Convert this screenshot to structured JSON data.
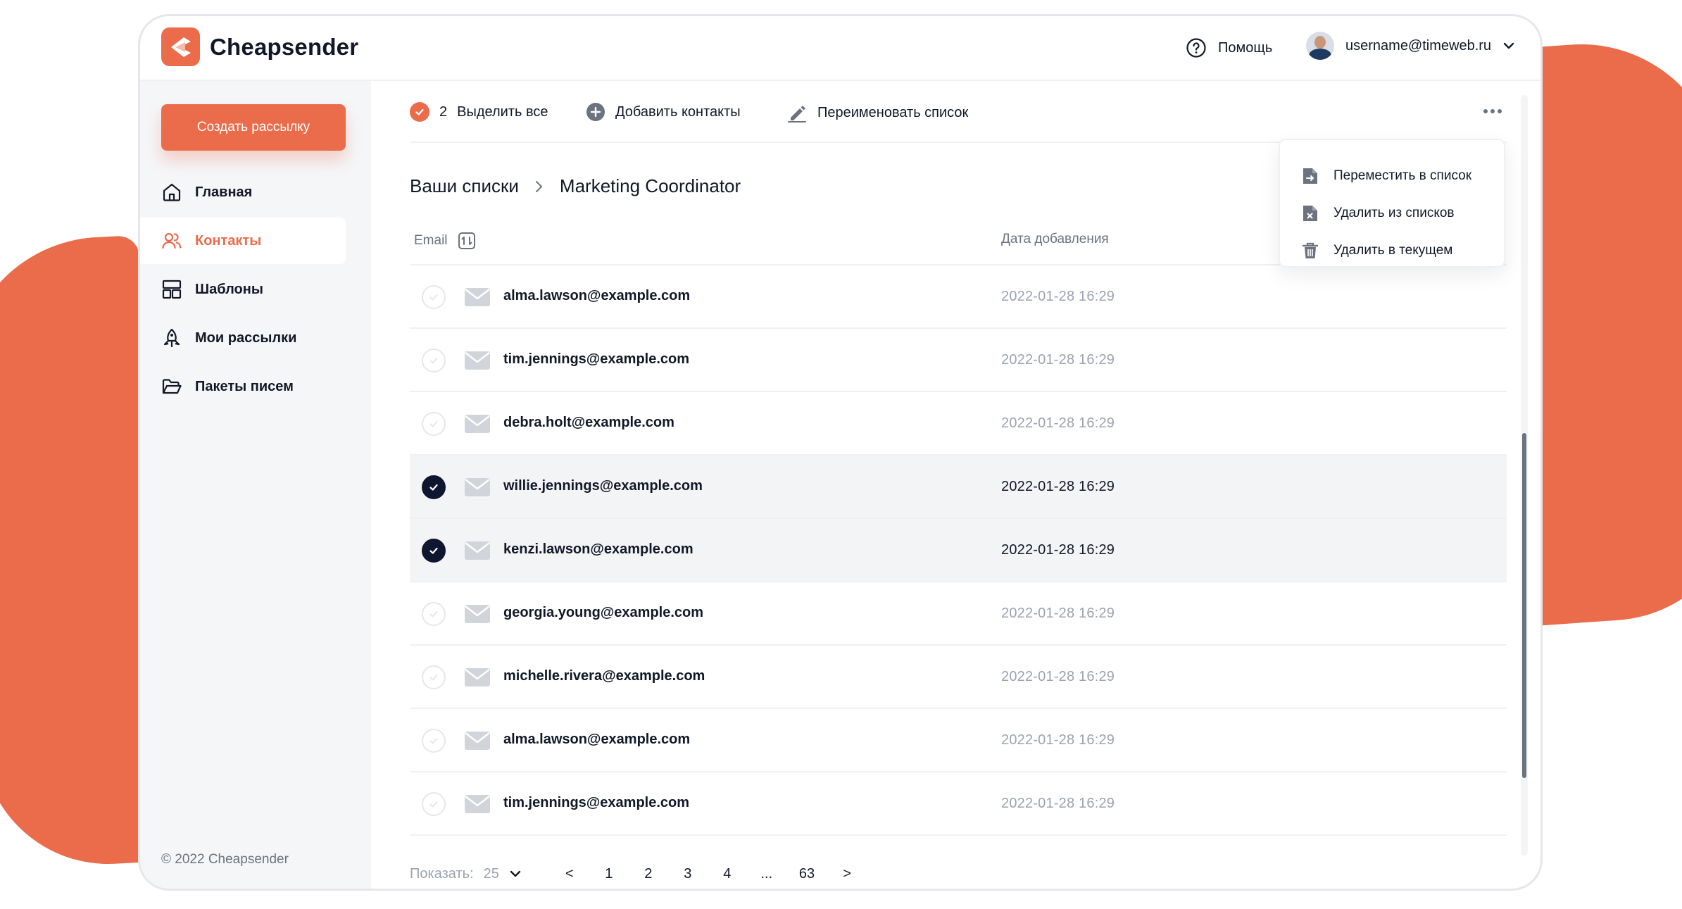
{
  "brand": {
    "name": "Cheapsender",
    "accent": "#EA6C4B"
  },
  "header": {
    "help_label": "Помощь",
    "user_email": "username@timeweb.ru"
  },
  "sidebar": {
    "create_label": "Создать рассылку",
    "items": [
      {
        "label": "Главная",
        "icon": "home-icon"
      },
      {
        "label": "Контакты",
        "icon": "contacts-icon",
        "active": true
      },
      {
        "label": "Шаблоны",
        "icon": "templates-icon"
      },
      {
        "label": "Мои рассылки",
        "icon": "mailings-icon"
      },
      {
        "label": "Пакеты писем",
        "icon": "folder-icon"
      }
    ],
    "copyright": "© 2022 Cheapsender"
  },
  "toolbar": {
    "selected_count": "2",
    "select_all_label": "Выделить все",
    "add_contacts_label": "Добавить контакты",
    "rename_label": "Переименовать список"
  },
  "dropdown": {
    "items": [
      {
        "label": "Переместить в список",
        "icon": "move-file-icon"
      },
      {
        "label": "Удалить из списков",
        "icon": "remove-file-icon"
      },
      {
        "label": "Удалить в текущем",
        "icon": "trash-icon"
      }
    ]
  },
  "breadcrumb": {
    "root": "Ваши списки",
    "current": "Marketing Coordinator"
  },
  "table": {
    "columns": {
      "email": "Email",
      "date": "Дата добавления"
    },
    "rows": [
      {
        "email": "alma.lawson@example.com",
        "date": "2022-01-28  16:29",
        "selected": false
      },
      {
        "email": "tim.jennings@example.com",
        "date": "2022-01-28  16:29",
        "selected": false
      },
      {
        "email": "debra.holt@example.com",
        "date": "2022-01-28  16:29",
        "selected": false
      },
      {
        "email": "willie.jennings@example.com",
        "date": "2022-01-28  16:29",
        "selected": true
      },
      {
        "email": "kenzi.lawson@example.com",
        "date": "2022-01-28  16:29",
        "selected": true
      },
      {
        "email": "georgia.young@example.com",
        "date": "2022-01-28  16:29",
        "selected": false
      },
      {
        "email": "michelle.rivera@example.com",
        "date": "2022-01-28  16:29",
        "selected": false
      },
      {
        "email": "alma.lawson@example.com",
        "date": "2022-01-28  16:29",
        "selected": false
      },
      {
        "email": "tim.jennings@example.com",
        "date": "2022-01-28  16:29",
        "selected": false
      }
    ]
  },
  "pagination": {
    "show_label": "Показать:",
    "page_size": "25",
    "pages": [
      "1",
      "2",
      "3",
      "4",
      "...",
      "63"
    ],
    "prev": "<",
    "next": ">"
  }
}
